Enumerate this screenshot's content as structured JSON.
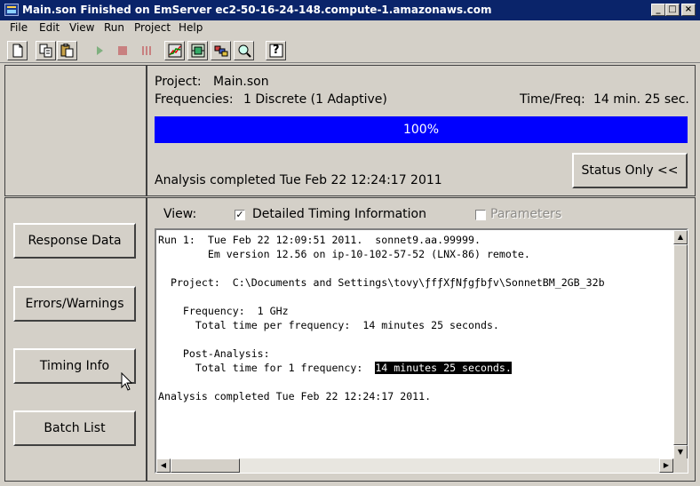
{
  "window": {
    "title": "Main.son    Finished on EmServer ec2-50-16-24-148.compute-1.amazonaws.com",
    "minimize": "_",
    "maximize": "□",
    "close": "×"
  },
  "menu": {
    "file": "File",
    "edit": "Edit",
    "view": "View",
    "run": "Run",
    "project": "Project",
    "help": "Help"
  },
  "toolbar": {
    "help_label": "?"
  },
  "status": {
    "project_label": "Project:",
    "project_value": "Main.son",
    "frequencies_label": "Frequencies:",
    "frequencies_value": "1 Discrete (1 Adaptive)",
    "time_freq_label": "Time/Freq:",
    "time_freq_value": "14 min. 25 sec.",
    "progress": 1.0,
    "progress_text": "100%",
    "completed_text": "Analysis completed Tue Feb 22 12:24:17 2011",
    "status_only_button": "Status Only <<"
  },
  "side_buttons": {
    "response_data": "Response Data",
    "errors_warnings": "Errors/Warnings",
    "timing_info": "Timing Info",
    "batch_list": "Batch List"
  },
  "view_options": {
    "label": "View:",
    "detailed_timing": "Detailed Timing Information",
    "detailed_timing_checked": true,
    "parameters": "Parameters",
    "parameters_checked": false
  },
  "log": {
    "line1": "Run 1:  Tue Feb 22 12:09:51 2011.  sonnet9.aa.99999.",
    "line2": "        Em version 12.56 on ip-10-102-57-52 (LNX-86) remote.",
    "line3": "",
    "line4": "  Project:  C:\\Documents and Settings\\tovy\\ƒfƒXƒNƒgƒbƒv\\SonnetBM_2GB_32b",
    "line5": "",
    "line6": "    Frequency:  1 GHz",
    "line7": "      Total time per frequency:  14 minutes 25 seconds.",
    "line8": "",
    "line9": "    Post-Analysis:",
    "line10_prefix": "      Total time for 1 frequency:  ",
    "line10_highlight": "14 minutes 25 seconds.",
    "line11": "",
    "line12": "Analysis completed Tue Feb 22 12:24:17 2011."
  },
  "colors": {
    "titlebar": "#0a246a",
    "progress": "#0000ff",
    "face": "#d4d0c8"
  }
}
